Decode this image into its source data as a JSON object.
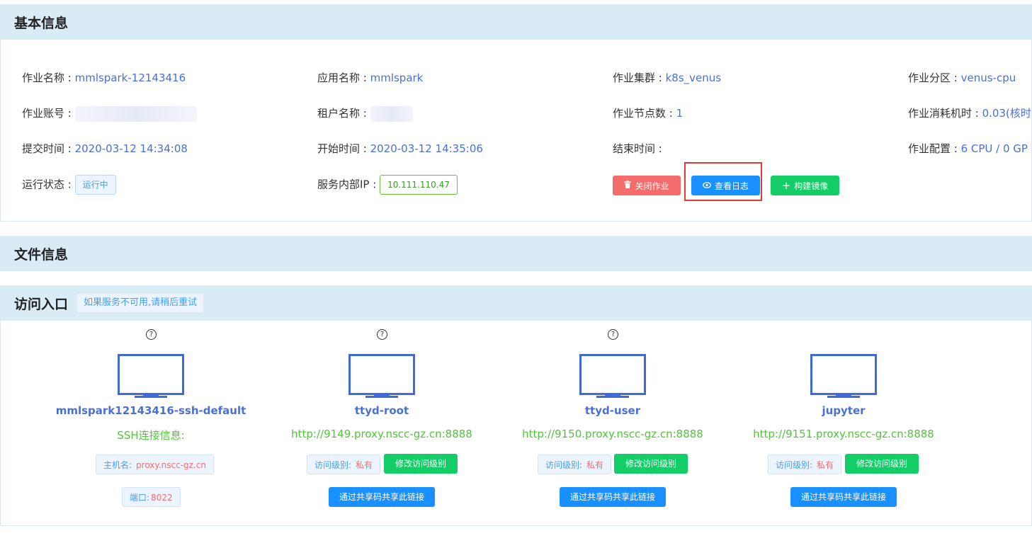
{
  "basic": {
    "title": "基本信息",
    "rows": [
      [
        {
          "label": "作业名称 : ",
          "value": "mmlspark-12143416"
        },
        {
          "label": "应用名称 : ",
          "value": "mmlspark"
        },
        {
          "label": "作业集群 : ",
          "value": "k8s_venus"
        },
        {
          "label": "作业分区 : ",
          "value": "venus-cpu"
        }
      ],
      [
        {
          "label": "作业账号 : ",
          "value": ""
        },
        {
          "label": "租户名称 : ",
          "value": ""
        },
        {
          "label": "作业节点数 : ",
          "value": "1"
        },
        {
          "label": "作业消耗机时 : ",
          "value": "0.03(核时"
        }
      ],
      [
        {
          "label": "提交时间 : ",
          "value": "2020-03-12 14:34:08"
        },
        {
          "label": "开始时间 : ",
          "value": "2020-03-12 14:35:06"
        },
        {
          "label": "结束时间 : ",
          "value": ""
        },
        {
          "label": "作业配置 : ",
          "value": "6 CPU / 0 GP"
        }
      ]
    ],
    "status_label": "运行状态 : ",
    "status_value": "运行中",
    "ip_label": "服务内部IP : ",
    "ip_value": "10.111.110.47",
    "buttons": {
      "close": "关闭作业",
      "log": "查看日志",
      "build": "构建镜像"
    }
  },
  "file": {
    "title": "文件信息"
  },
  "access": {
    "title": "访问入口",
    "hint": "如果服务不可用,请稍后重试",
    "cards": [
      {
        "name": "mmlspark12143416-ssh-default",
        "info": "SSH连接信息:",
        "host_label": "主机名:",
        "host_value": "proxy.nscc-gz.cn",
        "port_label": "端口:",
        "port_value": "8022"
      },
      {
        "name": "ttyd-root",
        "url": "http://9149.proxy.nscc-gz.cn:8888",
        "level_label": "访问级别:",
        "level_value": "私有",
        "modify_btn": "修改访问级别",
        "share_btn": "通过共享码共享此链接"
      },
      {
        "name": "ttyd-user",
        "url": "http://9150.proxy.nscc-gz.cn:8888",
        "level_label": "访问级别:",
        "level_value": "私有",
        "modify_btn": "修改访问级别",
        "share_btn": "通过共享码共享此链接"
      },
      {
        "name": "jupyter",
        "url": "http://9151.proxy.nscc-gz.cn:8888",
        "level_label": "访问级别:",
        "level_value": "私有",
        "modify_btn": "修改访问级别",
        "share_btn": "通过共享码共享此链接"
      }
    ]
  },
  "colors": {
    "section_bg": "#d9ebf5",
    "link_blue": "#4a6fd6",
    "url_green": "#51c43a",
    "danger": "#f56c6c",
    "primary": "#1890ff",
    "success": "#13ce66",
    "highlight_red": "#e53935"
  }
}
